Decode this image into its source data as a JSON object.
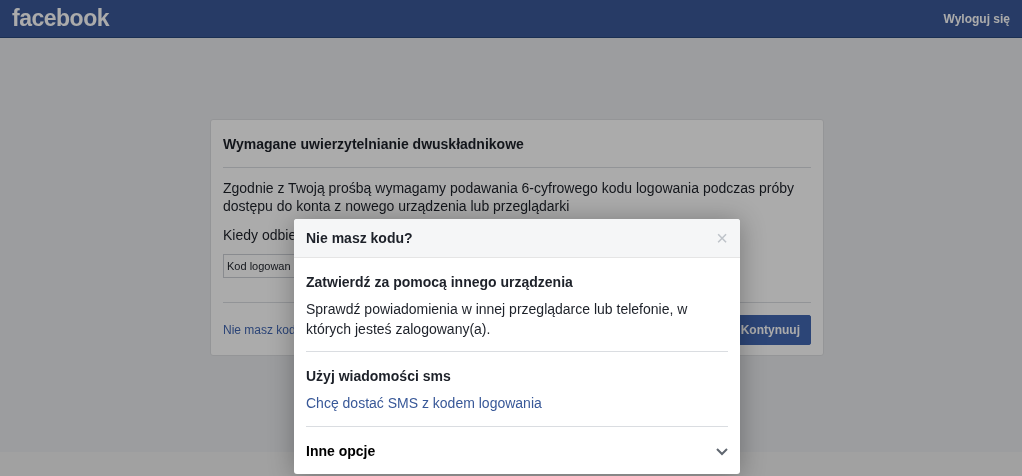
{
  "header": {
    "logo": "facebook",
    "logout": "Wyloguj się"
  },
  "card": {
    "title": "Wymagane uwierzytelnianie dwuskładnikowe",
    "description": [
      "Zgodnie z Twoją prośbą wymagamy podawania 6-cyfrowego kodu logowania podczas próby",
      "dostępu do konta z nowego urządzenia lub przeglądarki"
    ],
    "prompt": "Kiedy odbie",
    "code_field": {
      "placeholder": "Kod logowan"
    },
    "help_link": "Nie masz kod",
    "continue_button": "Kontynuuj"
  },
  "modal": {
    "title": "Nie masz kodu?",
    "close": "×",
    "sections": [
      {
        "kind": "info",
        "title": "Zatwierdź za pomocą innego urządzenia",
        "text": "Sprawdź powiadomienia w innej przeglądarce lub telefonie, w których jesteś zalogowany(a)."
      },
      {
        "kind": "link",
        "title": "Użyj wiadomości sms",
        "link": "Chcę dostać SMS z kodem logowania"
      },
      {
        "kind": "expander",
        "title": "Inne opcje",
        "expanded": false
      }
    ]
  }
}
